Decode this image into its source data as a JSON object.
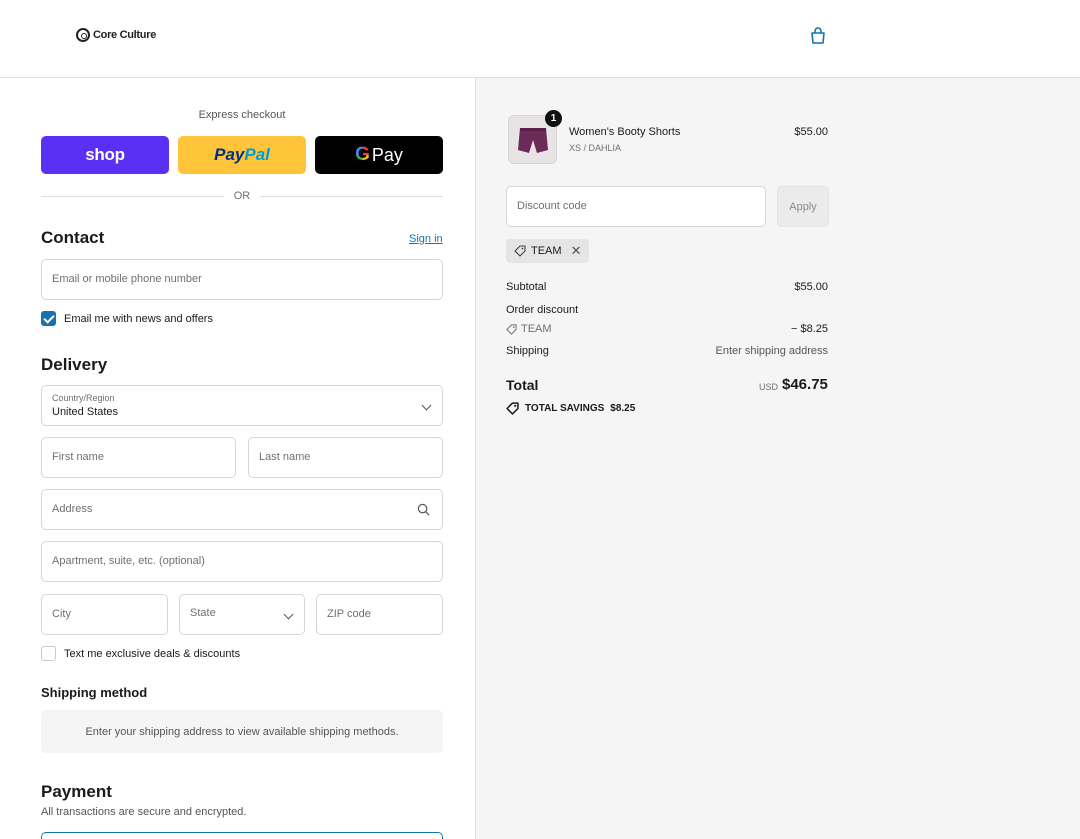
{
  "header": {
    "brand": "Core Culture",
    "cart_icon": "shopping-bag-icon"
  },
  "express": {
    "title": "Express checkout",
    "shop_label": "shop",
    "paypal_part1": "Pay",
    "paypal_part2": "Pal",
    "gpay_g": "G",
    "gpay_label": "Pay",
    "or_label": "OR"
  },
  "contact": {
    "title": "Contact",
    "sign_in": "Sign in",
    "email_placeholder": "Email or mobile phone number",
    "news_label": "Email me with news and offers",
    "news_checked": true
  },
  "delivery": {
    "title": "Delivery",
    "country_label": "Country/Region",
    "country_value": "United States",
    "first_name": "First name",
    "last_name": "Last name",
    "address": "Address",
    "apartment": "Apartment, suite, etc. (optional)",
    "city": "City",
    "state": "State",
    "zip": "ZIP code",
    "sms_label": "Text me exclusive deals & discounts",
    "sms_checked": false
  },
  "shipping_method": {
    "title": "Shipping method",
    "message": "Enter your shipping address to view available shipping methods."
  },
  "payment": {
    "title": "Payment",
    "subtitle": "All transactions are secure and encrypted."
  },
  "summary": {
    "item": {
      "name": "Women's Booty Shorts",
      "variant": "XS / DAHLIA",
      "price": "$55.00",
      "quantity": "1",
      "image_color": "#6b2a57"
    },
    "discount_placeholder": "Discount code",
    "apply_label": "Apply",
    "applied_code": "TEAM",
    "subtotal_label": "Subtotal",
    "subtotal_value": "$55.00",
    "order_discount_label": "Order discount",
    "discount_code": "TEAM",
    "discount_value": "− $8.25",
    "shipping_label": "Shipping",
    "shipping_value": "Enter shipping address",
    "total_label": "Total",
    "currency": "USD",
    "total_value": "$46.75",
    "savings_label": "TOTAL SAVINGS",
    "savings_value": "$8.25"
  },
  "colors": {
    "accent": "#1773b0",
    "shop_purple": "#5a31f4",
    "paypal_yellow": "#ffc439"
  }
}
